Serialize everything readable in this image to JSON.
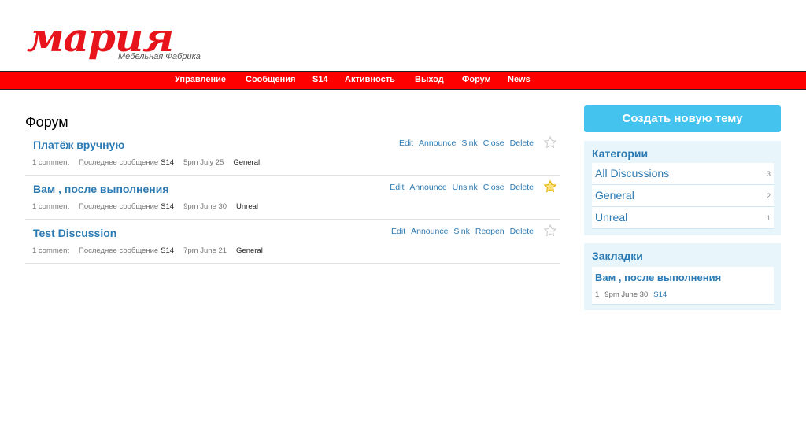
{
  "brand": {
    "logo_text": "мария",
    "reg_mark": "®",
    "tagline": "Мебельная Фабрика"
  },
  "nav": {
    "items": [
      "Управление",
      "Сообщения",
      "S14",
      "Активность",
      "Выход",
      "Форум",
      "News"
    ]
  },
  "page_title": "Форум",
  "discussions": [
    {
      "title": "Платёж вручную",
      "options": [
        "Edit",
        "Announce",
        "Sink",
        "Close",
        "Delete"
      ],
      "starred": false,
      "comments": "1 comment",
      "last_label": "Последнее сообщение",
      "last_user": "S14",
      "time": "5pm July 25",
      "category": "General"
    },
    {
      "title": "Вам , после выполнения",
      "options": [
        "Edit",
        "Announce",
        "Unsink",
        "Close",
        "Delete"
      ],
      "starred": true,
      "comments": "1 comment",
      "last_label": "Последнее сообщение",
      "last_user": "S14",
      "time": "9pm June 30",
      "category": "Unreal"
    },
    {
      "title": "Test Discussion",
      "options": [
        "Edit",
        "Announce",
        "Sink",
        "Reopen",
        "Delete"
      ],
      "starred": false,
      "comments": "1 comment",
      "last_label": "Последнее сообщение",
      "last_user": "S14",
      "time": "7pm June 21",
      "category": "General"
    }
  ],
  "sidebar": {
    "new_discussion_label": "Создать новую тему",
    "categories_title": "Категории",
    "categories": [
      {
        "label": "All Discussions",
        "count": "3"
      },
      {
        "label": "General",
        "count": "2"
      },
      {
        "label": "Unreal",
        "count": "1"
      }
    ],
    "bookmarks_title": "Закладки",
    "bookmark": {
      "title": "Вам , после выполнения",
      "count": "1",
      "time": "9pm June 30",
      "user": "S14"
    }
  },
  "colors": {
    "brand_red": "#ff0000",
    "link_blue": "#2b7ab3",
    "button_blue": "#45c3ef",
    "sidebar_bg": "#e8f6fc",
    "star_gold": "#f5c518"
  }
}
